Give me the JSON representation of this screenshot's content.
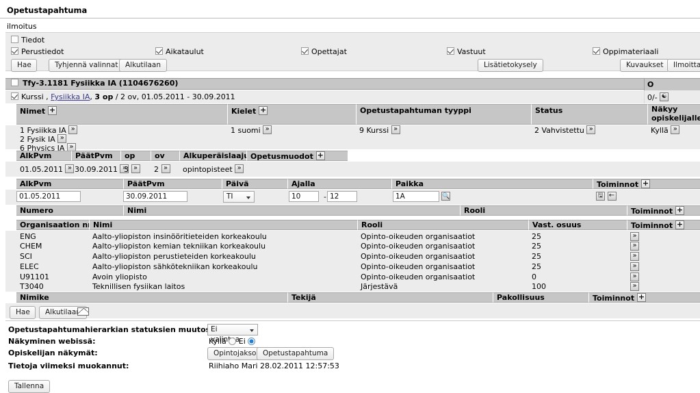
{
  "app": {
    "title": "Opetustapahtuma",
    "subtitle": "ilmoitus"
  },
  "filters": {
    "master_checkbox": {
      "label": "Tiedot",
      "checked": false
    },
    "checkboxes": [
      {
        "label": "Perustiedot",
        "checked": true
      },
      {
        "label": "Aikataulut",
        "checked": true
      },
      {
        "label": "Opettajat",
        "checked": true
      },
      {
        "label": "Vastuut",
        "checked": true
      },
      {
        "label": "Oppimateriaali",
        "checked": true
      }
    ],
    "buttons_left": [
      "Hae",
      "Tyhjennä valinnat",
      "Alkutilaan"
    ],
    "button_mid": "Lisätietokysely",
    "buttons_right": [
      "Kuvaukset",
      "Ilmoittautu"
    ]
  },
  "course": {
    "header_checked": false,
    "header_title": "Tfy-3.1181 Fysiikka IA (1104676260)",
    "header_right_col": "O",
    "sub_checked": true,
    "sub_type": "Kurssi ,",
    "sub_link": "Fysiikka IA",
    "sub_comma": ",",
    "sub_credits": "3 op",
    "sub_rest": "/ 2 ov, 01.05.2011 - 30.09.2011",
    "sub_right_value": "0/-"
  },
  "info_grid": {
    "headers": {
      "nimet": "Nimet",
      "kielet": "Kielet",
      "tyyppi": "Opetustapahtuman tyyppi",
      "status": "Status",
      "nakyy_line1": "Näkyy",
      "nakyy_line2": "opiskelijalle"
    },
    "names": [
      "1 Fysiikka IA",
      "2 Fysik IA",
      "6 Physics IA"
    ],
    "kielet": "1 suomi",
    "tyyppi": "9 Kurssi",
    "status": "2 Vahvistettu",
    "nakyy": "Kyllä"
  },
  "detail_grid": {
    "headers": {
      "alkpvm": "AlkPvm",
      "paatpvm": "PäätPvm",
      "op": "op",
      "ov": "ov",
      "alkuperaislaajuus": "Alkuperäislaajuus",
      "opetusmuodot": "Opetusmuodot"
    },
    "values": {
      "alkpvm": "01.05.2011",
      "paatpvm": "30.09.2011",
      "op": "3",
      "ov": "2",
      "alkuperaislaajuus": "opintopisteet"
    }
  },
  "schedule_grid": {
    "headers": {
      "alkpvm": "AlkPvm",
      "paatpvm": "PäätPvm",
      "paiva": "Päivä",
      "ajalla": "Ajalla",
      "paikka": "Paikka",
      "toiminnot": "Toiminnot"
    },
    "values": {
      "alkpvm": "01.05.2011",
      "paatpvm": "30.09.2011",
      "paiva": "TI",
      "aika_alku": "10",
      "aika_sep": "-",
      "aika_loppu": "12",
      "paikka": "1A"
    }
  },
  "teacher_grid": {
    "headers": {
      "numero": "Numero",
      "nimi": "Nimi",
      "rooli": "Rooli",
      "toiminnot": "Toiminnot"
    }
  },
  "org_grid": {
    "headers": {
      "nro": "Organisaation nro",
      "nimi": "Nimi",
      "rooli": "Rooli",
      "osuus": "Vast. osuus",
      "toiminnot": "Toiminnot"
    },
    "rows": [
      {
        "nro": "ENG",
        "nimi": "Aalto-yliopiston insinööritieteiden korkeakoulu",
        "rooli": "Opinto-oikeuden organisaatiot",
        "osuus": "25"
      },
      {
        "nro": "CHEM",
        "nimi": "Aalto-yliopiston kemian tekniikan korkeakoulu",
        "rooli": "Opinto-oikeuden organisaatiot",
        "osuus": "25"
      },
      {
        "nro": "SCI",
        "nimi": "Aalto-yliopiston perustieteiden korkeakoulu",
        "rooli": "Opinto-oikeuden organisaatiot",
        "osuus": "25"
      },
      {
        "nro": "ELEC",
        "nimi": "Aalto-yliopiston sähkötekniikan korkeakoulu",
        "rooli": "Opinto-oikeuden organisaatiot",
        "osuus": "25"
      },
      {
        "nro": "U91101",
        "nimi": "Avoin yliopisto",
        "rooli": "Opinto-oikeuden organisaatiot",
        "osuus": "0"
      },
      {
        "nro": "T3040",
        "nimi": "Teknillisen fysiikan laitos",
        "rooli": "Järjestävä",
        "osuus": "100"
      }
    ]
  },
  "material_grid": {
    "headers": {
      "nimike": "Nimike",
      "tekija": "Tekijä",
      "pakollisuus": "Pakollisuus",
      "toiminnot": "Toiminnot"
    },
    "buttons": [
      "Hae",
      "Alkutilaan"
    ]
  },
  "footer": {
    "status_change_label": "Opetustapahtumahierarkian statuksien muutos:",
    "status_change_value": "Ei valintaa",
    "web_visibility_label": "Näkyminen webissä:",
    "web_visibility_yes": "Kyllä",
    "web_visibility_no": "Ei",
    "web_visibility_selected": "Ei",
    "student_views_label": "Opiskelijan näkymät:",
    "student_view_buttons": [
      "Opintojakso",
      "Opetustapahtuma"
    ],
    "last_modified_label": "Tietoja viimeksi muokannut:",
    "last_modified_value": "Riihiaho Mari 28.02.2011 12:57:53",
    "save_button": "Tallenna"
  }
}
